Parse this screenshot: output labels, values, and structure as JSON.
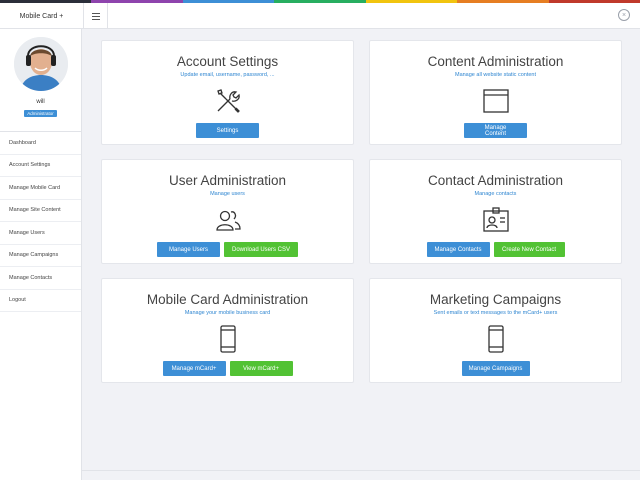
{
  "stripe_colors": [
    "#2b2f3a",
    "#8e44ad",
    "#3d8fd6",
    "#27ae60",
    "#f1c40f",
    "#e67e22",
    "#c0392b"
  ],
  "header": {
    "brand": "Mobile Card +",
    "menu_icon": "hamburger-icon",
    "close_icon": "close-circle-icon",
    "close_glyph": "×"
  },
  "profile": {
    "username": "will",
    "role": "Administrator"
  },
  "sidebar": {
    "items": [
      {
        "label": "Dashboard"
      },
      {
        "label": "Account Settings"
      },
      {
        "label": "Manage Mobile Card"
      },
      {
        "label": "Manage Site Content"
      },
      {
        "label": "Manage Users"
      },
      {
        "label": "Manage Campaigns"
      },
      {
        "label": "Manage Contacts"
      },
      {
        "label": "Logout"
      }
    ]
  },
  "cards": {
    "account": {
      "title": "Account Settings",
      "subtitle": "Update email, username, password, ...",
      "icon": "tools-icon",
      "buttons": [
        "Settings"
      ]
    },
    "content": {
      "title": "Content Administration",
      "subtitle": "Manage all website static content",
      "icon": "browser-window-icon",
      "buttons": [
        "Manage Content"
      ]
    },
    "users": {
      "title": "User Administration",
      "subtitle": "Manage users",
      "icon": "users-icon",
      "buttons": [
        "Manage Users",
        "Download Users CSV"
      ]
    },
    "contacts": {
      "title": "Contact Administration",
      "subtitle": "Manage contacts",
      "icon": "contact-card-icon",
      "buttons": [
        "Manage Contacts",
        "Create New Contact"
      ]
    },
    "mobilecard": {
      "title": "Mobile Card Administration",
      "subtitle": "Manage your mobile business card",
      "icon": "mobile-phone-icon",
      "buttons": [
        "Manage mCard+",
        "View mCard+"
      ]
    },
    "campaigns": {
      "title": "Marketing Campaigns",
      "subtitle": "Sent emails or text messages to the mCard+ users",
      "icon": "mobile-phone-icon",
      "buttons": [
        "Manage Campaigns"
      ]
    }
  }
}
